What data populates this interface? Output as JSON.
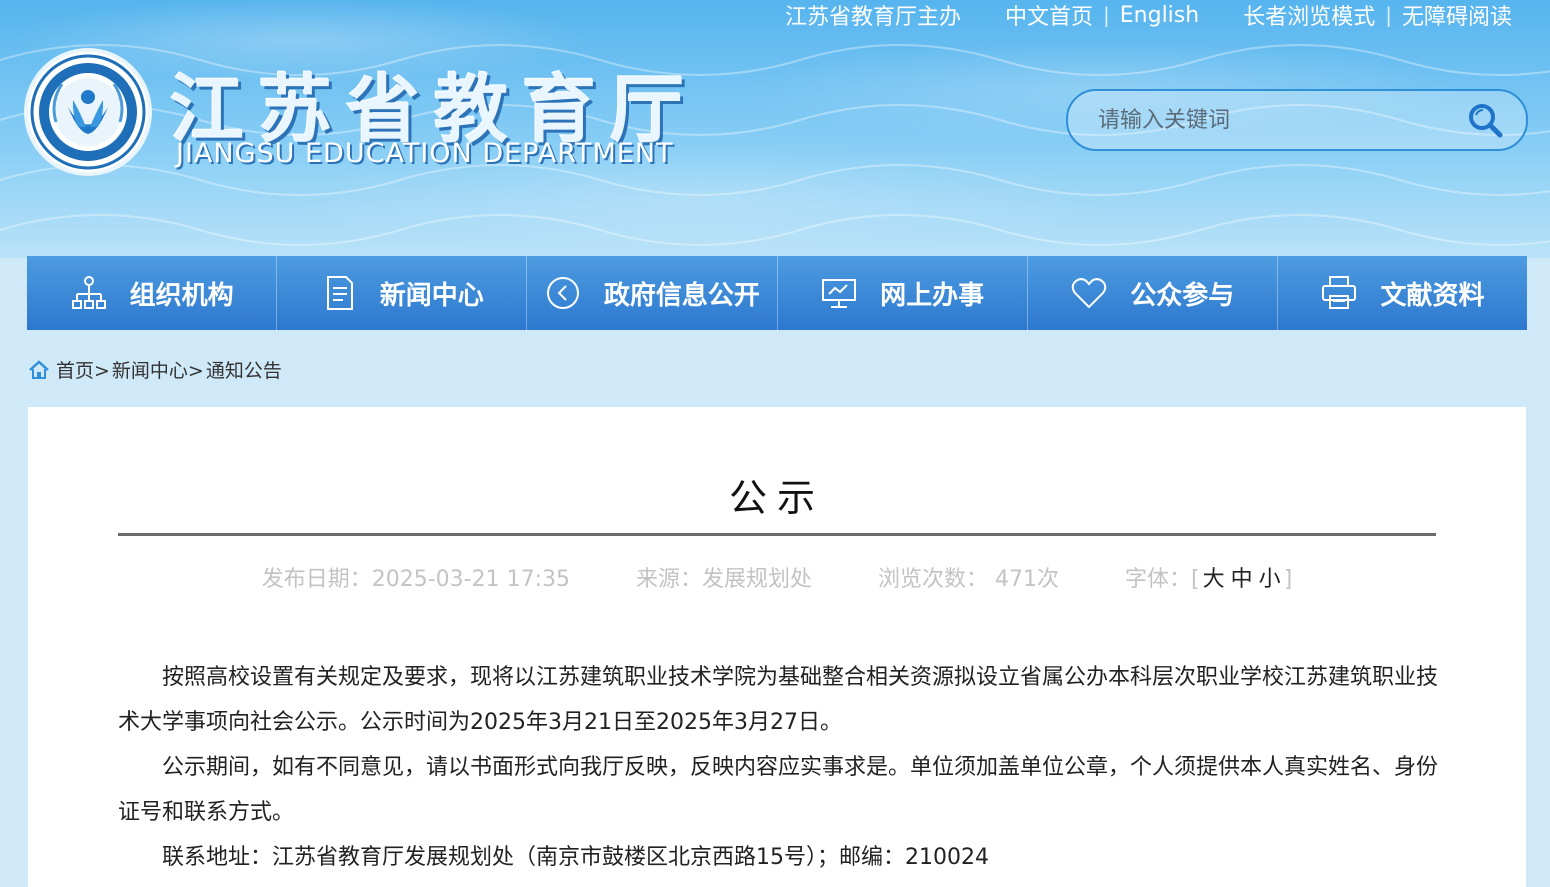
{
  "top_links": [
    "江苏省教育厅主办",
    "中文首页",
    "English",
    "长者浏览模式",
    "无障碍阅读"
  ],
  "logo": {
    "title": "江苏省教育厅",
    "subtitle": "JIANGSU EDUCATION DEPARTMENT"
  },
  "search": {
    "placeholder": "请输入关键词"
  },
  "nav": [
    {
      "label": "组织机构",
      "icon": "org-chart-icon"
    },
    {
      "label": "新闻中心",
      "icon": "document-icon"
    },
    {
      "label": "政府信息公开",
      "icon": "circle-arrow-icon"
    },
    {
      "label": "网上办事",
      "icon": "monitor-icon"
    },
    {
      "label": "公众参与",
      "icon": "heart-icon"
    },
    {
      "label": "文献资料",
      "icon": "printer-icon"
    }
  ],
  "breadcrumb": [
    "首页>",
    "新闻中心>",
    "通知公告"
  ],
  "article": {
    "title": "公示",
    "date_label": "发布日期：",
    "date": "2025-03-21 17:35",
    "source_label": "来源：",
    "source": "发展规划处",
    "views_label": "浏览次数：",
    "views": "471次",
    "font_label": "字体：",
    "font_open": "[",
    "font_large": "大",
    "font_medium": "中",
    "font_small": "小",
    "font_close": "]",
    "paragraphs": [
      "按照高校设置有关规定及要求，现将以江苏建筑职业技术学院为基础整合相关资源拟设立省属公办本科层次职业学校江苏建筑职业技术大学事项向社会公示。公示时间为2025年3月21日至2025年3月27日。",
      "公示期间，如有不同意见，请以书面形式向我厅反映，反映内容应实事求是。单位须加盖单位公章，个人须提供本人真实姓名、身份证号和联系方式。",
      "联系地址：江苏省教育厅发展规划处（南京市鼓楼区北京西路15号）；邮编：210024"
    ]
  }
}
